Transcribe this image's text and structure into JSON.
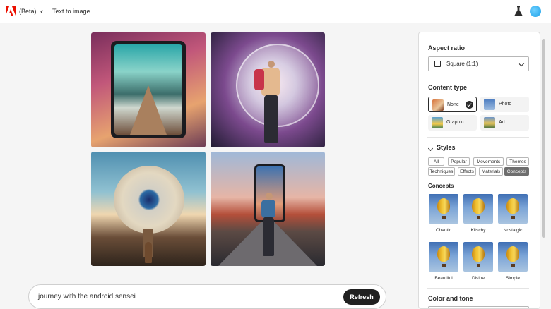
{
  "header": {
    "beta_label": "(Beta)",
    "back_glyph": "‹",
    "page_title": "Text to image",
    "logo_icon": "adobe-logo-icon",
    "labs_icon": "flask-icon"
  },
  "gallery": {
    "images": [
      {
        "description_icon": "tablet-road-image"
      },
      {
        "description_icon": "traveler-bubble-image"
      },
      {
        "description_icon": "globe-tree-image"
      },
      {
        "description_icon": "phone-walker-image"
      }
    ]
  },
  "prompt": {
    "text": "journey with the android sensei",
    "refresh_label": "Refresh"
  },
  "panel": {
    "aspect_ratio": {
      "title": "Aspect ratio",
      "value": "Square (1:1)"
    },
    "content_type": {
      "title": "Content type",
      "options": [
        {
          "label": "None",
          "selected": true
        },
        {
          "label": "Photo",
          "selected": false
        },
        {
          "label": "Graphic",
          "selected": false
        },
        {
          "label": "Art",
          "selected": false
        }
      ]
    },
    "styles": {
      "title": "Styles",
      "chips": [
        "All",
        "Popular",
        "Movements",
        "Themes",
        "Techniques",
        "Effects",
        "Materials",
        "Concepts"
      ],
      "active_chip": "Concepts",
      "concepts_title": "Concepts",
      "concepts": [
        "Chaotic",
        "Kitschy",
        "Nostalgic",
        "Beautiful",
        "Divine",
        "Simple"
      ]
    },
    "color_and_tone": {
      "title": "Color and tone"
    }
  },
  "colors": {
    "accent": "#202020",
    "adobe_red": "#eb1000",
    "avatar": "#1aa0e8"
  }
}
